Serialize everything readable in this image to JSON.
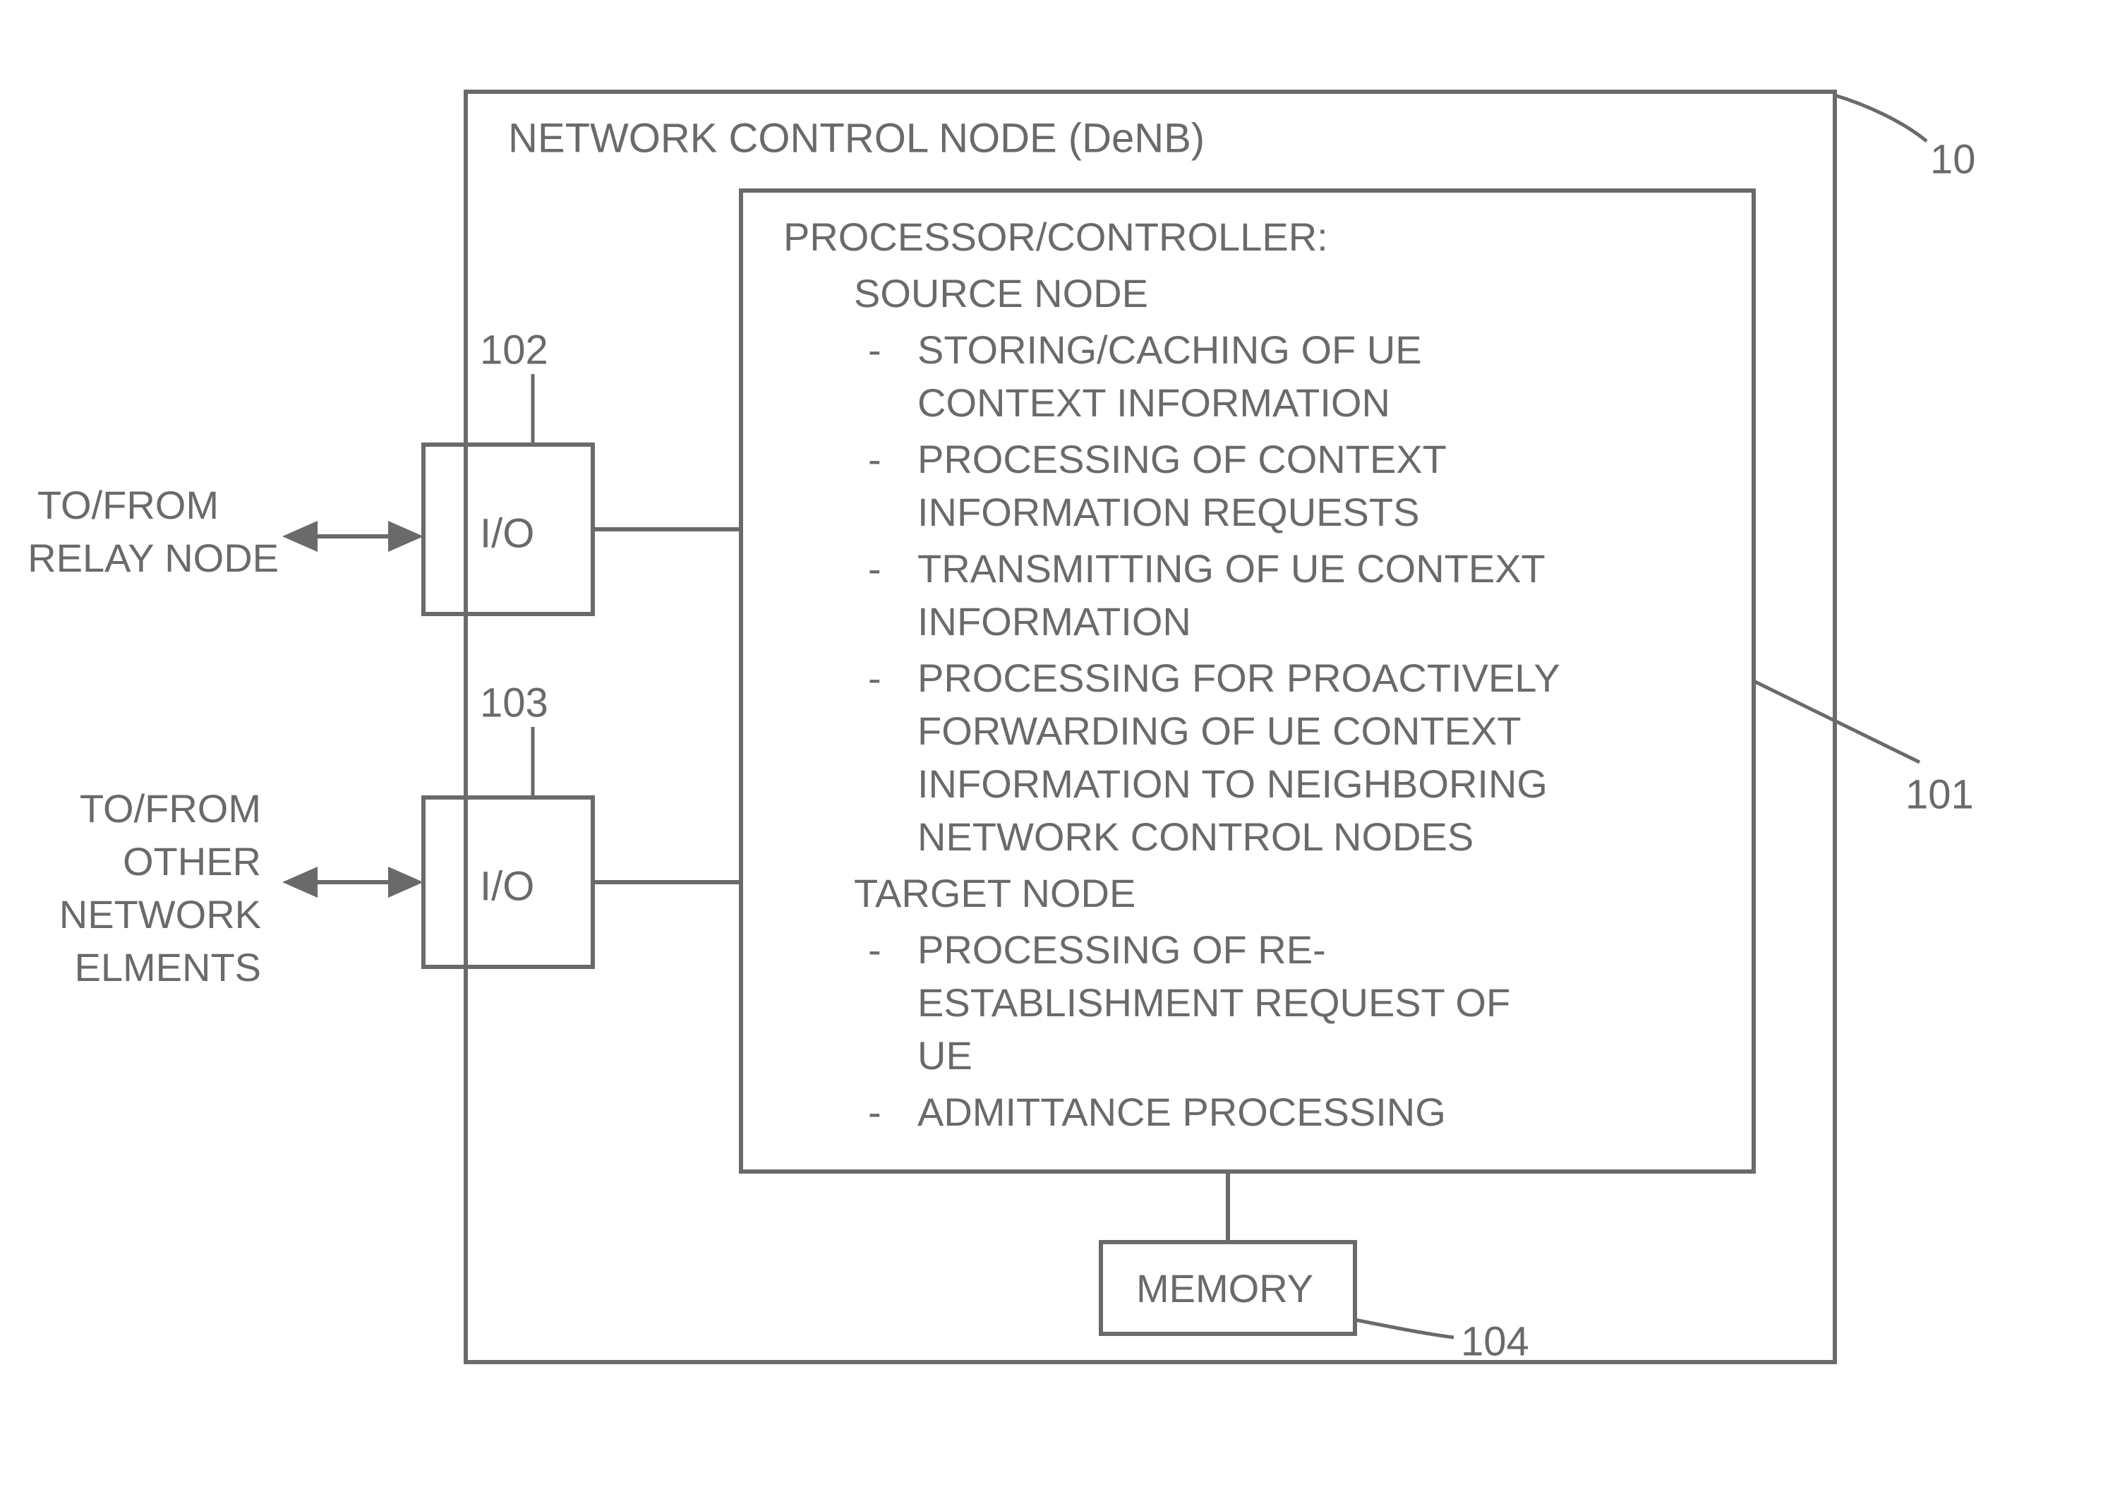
{
  "outer": {
    "title": "NETWORK CONTROL NODE (DeNB)",
    "ref": "10"
  },
  "io1": {
    "text": "I/O",
    "ref": "102"
  },
  "io2": {
    "text": "I/O",
    "ref": "103"
  },
  "ext1": {
    "l1": "TO/FROM",
    "l2": "RELAY NODE"
  },
  "ext2": {
    "l1": "TO/FROM",
    "l2": "OTHER",
    "l3": "NETWORK",
    "l4": "ELMENTS"
  },
  "proc": {
    "title": "PROCESSOR/CONTROLLER:",
    "sec1": "SOURCE NODE",
    "b1a": "STORING/CACHING OF UE",
    "b1b": "CONTEXT INFORMATION",
    "b2a": "PROCESSING OF CONTEXT",
    "b2b": "INFORMATION REQUESTS",
    "b3a": "TRANSMITTING OF UE CONTEXT",
    "b3b": "INFORMATION",
    "b4a": "PROCESSING FOR PROACTIVELY",
    "b4b": "FORWARDING OF UE CONTEXT",
    "b4c": "INFORMATION TO NEIGHBORING",
    "b4d": "NETWORK CONTROL NODES",
    "sec2": "TARGET NODE",
    "b5a": "PROCESSING OF RE-",
    "b5b": "ESTABLISHMENT REQUEST OF",
    "b5c": "UE",
    "b6": "ADMITTANCE PROCESSING",
    "ref": "101"
  },
  "mem": {
    "label": "MEMORY",
    "ref": "104"
  }
}
